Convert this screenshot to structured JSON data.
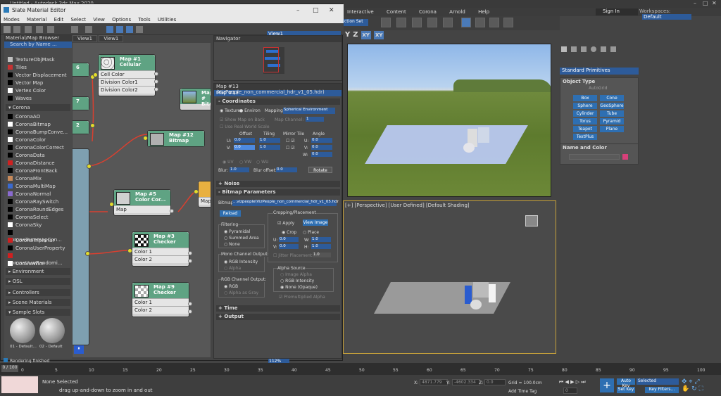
{
  "app": {
    "title": "Untitled - Autodesk 3ds Max 2020",
    "menu": [
      "Interactive",
      "Content",
      "Corona",
      "Arnold",
      "Help"
    ],
    "sign_in": "Sign In",
    "workspaces_label": "Workspaces:",
    "workspaces_value": "Default",
    "selection_set": "ction Set"
  },
  "axis_constraints": [
    "Y",
    "Z",
    "XY",
    "XY"
  ],
  "viewport_bottom_label": "[+] [Perspective] [User Defined] [Default Shading]",
  "command_panel": {
    "dropdown": "Standard Primitives",
    "object_type_title": "Object Type",
    "autogrid": "AutoGrid",
    "buttons": [
      "Box",
      "Cone",
      "Sphere",
      "GeoSphere",
      "Cylinder",
      "Tube",
      "Torus",
      "Pyramid",
      "Teapot",
      "Plane",
      "TextPlus"
    ],
    "name_color_title": "Name and Color"
  },
  "slate": {
    "title": "Slate Material Editor",
    "menu": [
      "Modes",
      "Material",
      "Edit",
      "Select",
      "View",
      "Options",
      "Tools",
      "Utilities"
    ],
    "browser_title": "Material/Map Browser",
    "search_placeholder": "Search by Name ...",
    "browser_items_top": [
      {
        "name": "TextureObjMask",
        "color": "#c0c0c0"
      },
      {
        "name": "Tiles",
        "color": "#c83232"
      },
      {
        "name": "Vector Displacement",
        "color": "#000000"
      },
      {
        "name": "Vector Map",
        "color": "#000000"
      },
      {
        "name": "Vertex Color",
        "color": "#ffffff"
      },
      {
        "name": "Waves",
        "color": "#000000"
      }
    ],
    "corona_section": "Corona",
    "corona_items": [
      {
        "name": "CoronaAO",
        "color": "#000000"
      },
      {
        "name": "CoronaBitmap",
        "color": "#ffffff"
      },
      {
        "name": "CoronaBumpConve...",
        "color": "#000000"
      },
      {
        "name": "CoronaColor",
        "color": "#ffffff"
      },
      {
        "name": "CoronaColorCorrect",
        "color": "#000000"
      },
      {
        "name": "CoronaData",
        "color": "#000000"
      },
      {
        "name": "CoronaDistance",
        "color": "#d02020"
      },
      {
        "name": "CoronaFrontBack",
        "color": "#000000"
      },
      {
        "name": "CoronaMix",
        "color": "#c88a5a"
      },
      {
        "name": "CoronaMultiMap",
        "color": "#3a6ad0"
      },
      {
        "name": "CoronaNormal",
        "color": "#8a6ad0"
      },
      {
        "name": "CoronaRaySwitch",
        "color": "#000000"
      },
      {
        "name": "CoronaRoundEdges",
        "color": "#000000"
      },
      {
        "name": "CoronaSelect",
        "color": "#000000"
      },
      {
        "name": "CoronaSky",
        "color": "#ffffff"
      },
      {
        "name": "CoronaTonemapCon...",
        "color": "#000000"
      },
      {
        "name": "CoronaTriplanar",
        "color": "#d02020"
      },
      {
        "name": "CoronaUserProperty",
        "color": "#000000"
      },
      {
        "name": "CoronaUvwRandomi...",
        "color": "#d02020"
      },
      {
        "name": "CoronaWire",
        "color": "#ffffff"
      }
    ],
    "sections_bottom": [
      "Environment",
      "OSL",
      "Controllers",
      "Scene Materials",
      "Sample Slots"
    ],
    "sample_slots": [
      "01 - Default...",
      "02 - Default"
    ],
    "view_tabs": [
      "View1",
      "View1"
    ],
    "view_select": "View1",
    "navigator_title": "Navigator",
    "nodes": [
      {
        "title": "Map #1",
        "sub": "Cellular",
        "rows": [
          "Cell Color",
          "Division Color1",
          "Division Color2"
        ]
      },
      {
        "title": "Map #",
        "sub": "Bitm",
        "rows": []
      },
      {
        "title": "Map #12",
        "sub": "Bitmap",
        "rows": []
      },
      {
        "title": "Map #5",
        "sub": "Color Cor...",
        "rows": [
          "Map"
        ]
      },
      {
        "title": "Map #3",
        "sub": "Checker",
        "rows": [
          "Color 1",
          "Color 2"
        ]
      },
      {
        "title": "Map #9",
        "sub": "Checker",
        "rows": [
          "Color 1",
          "Color 2"
        ]
      },
      {
        "title": "",
        "sub": "",
        "rows": [
          "Map"
        ]
      }
    ],
    "left_node_numbers": [
      "6",
      "7",
      "2"
    ],
    "param_title": "Map #13 (VizPeople_non_commercial_hdr_v1_05.hdr)",
    "param_name": "Map #13",
    "coordinates": {
      "title": "Coordinates",
      "texture": "Texture",
      "environ": "Environ",
      "mapping_label": "Mapping:",
      "mapping_value": "Spherical Environment",
      "show_map_on_back": "Show Map on Back",
      "map_channel_label": "Map Channel:",
      "map_channel_value": "1",
      "real_world": "Use Real-World Scale",
      "offset": "Offset",
      "tiling": "Tiling",
      "mirror_tile": "Mirror Tile",
      "angle": "Angle",
      "u_label": "U:",
      "v_label": "V:",
      "w_label": "W:",
      "u_offset": "0.0",
      "v_offset": "0.0",
      "u_tiling": "1.0",
      "v_tiling": "1.0",
      "u_angle": "0.0",
      "v_angle": "0.0",
      "w_angle": "0.0",
      "uv": "UV",
      "vw": "VW",
      "wu": "WU",
      "blur_label": "Blur:",
      "blur_value": "1.0",
      "blur_offset_label": "Blur offset:",
      "blur_offset_value": "0.0",
      "rotate": "Rotate"
    },
    "noise_title": "Noise",
    "bitmap_params": {
      "title": "Bitmap Parameters",
      "bitmap_label": "Bitmap:",
      "bitmap_path": "...vizpeople\\VizPeople_non_commercial_hdr_v1_05.hdr",
      "reload": "Reload",
      "cropping_title": "Cropping/Placement",
      "apply": "Apply",
      "view_image": "View Image",
      "crop": "Crop",
      "place": "Place",
      "u_label": "U:",
      "v_label": "V:",
      "w_label": "W:",
      "h_label": "H:",
      "u_value": "0.0",
      "v_value": "0.0",
      "w_value": "1.0",
      "h_value": "1.0",
      "jitter": "Jitter Placement:",
      "jitter_value": "1.0",
      "filtering_title": "Filtering",
      "pyramidal": "Pyramidal",
      "summed_area": "Summed Area",
      "none": "None",
      "mono_title": "Mono Channel Output:",
      "rgb_intensity": "RGB Intensity",
      "alpha": "Alpha",
      "alpha_source_title": "Alpha Source",
      "image_alpha": "Image Alpha",
      "rgb_intensity2": "RGB Intensity",
      "none_opaque": "None (Opaque)",
      "rgb_channel_title": "RGB Channel Output:",
      "rgb": "RGB",
      "alpha_as_gray": "Alpha as Gray",
      "premultiplied": "Premultiplied Alpha"
    },
    "time_title": "Time",
    "output_title": "Output",
    "zoom": "112%",
    "rendering_status": "Rendering finished"
  },
  "timeline": {
    "ticks": [
      "0",
      "5",
      "10",
      "15",
      "20",
      "25",
      "30",
      "35",
      "40",
      "45",
      "50",
      "55",
      "60",
      "65",
      "70",
      "75",
      "80",
      "85",
      "90",
      "95",
      "100"
    ],
    "frame": "0 / 100"
  },
  "status": {
    "selection": "None Selected",
    "hint": "drag up-and-down to zoom in and out",
    "x_label": "X:",
    "x_value": "4871.779",
    "y_label": "Y:",
    "y_value": "-4602.334",
    "z_label": "Z:",
    "z_value": "0.0",
    "grid": "Grid = 100.0cm",
    "add_time_tag": "Add Time Tag",
    "auto_key": "Auto Key",
    "set_key": "Set Key",
    "selected": "Selected",
    "key_filters": "Key Filters...",
    "frame_value": "0"
  }
}
